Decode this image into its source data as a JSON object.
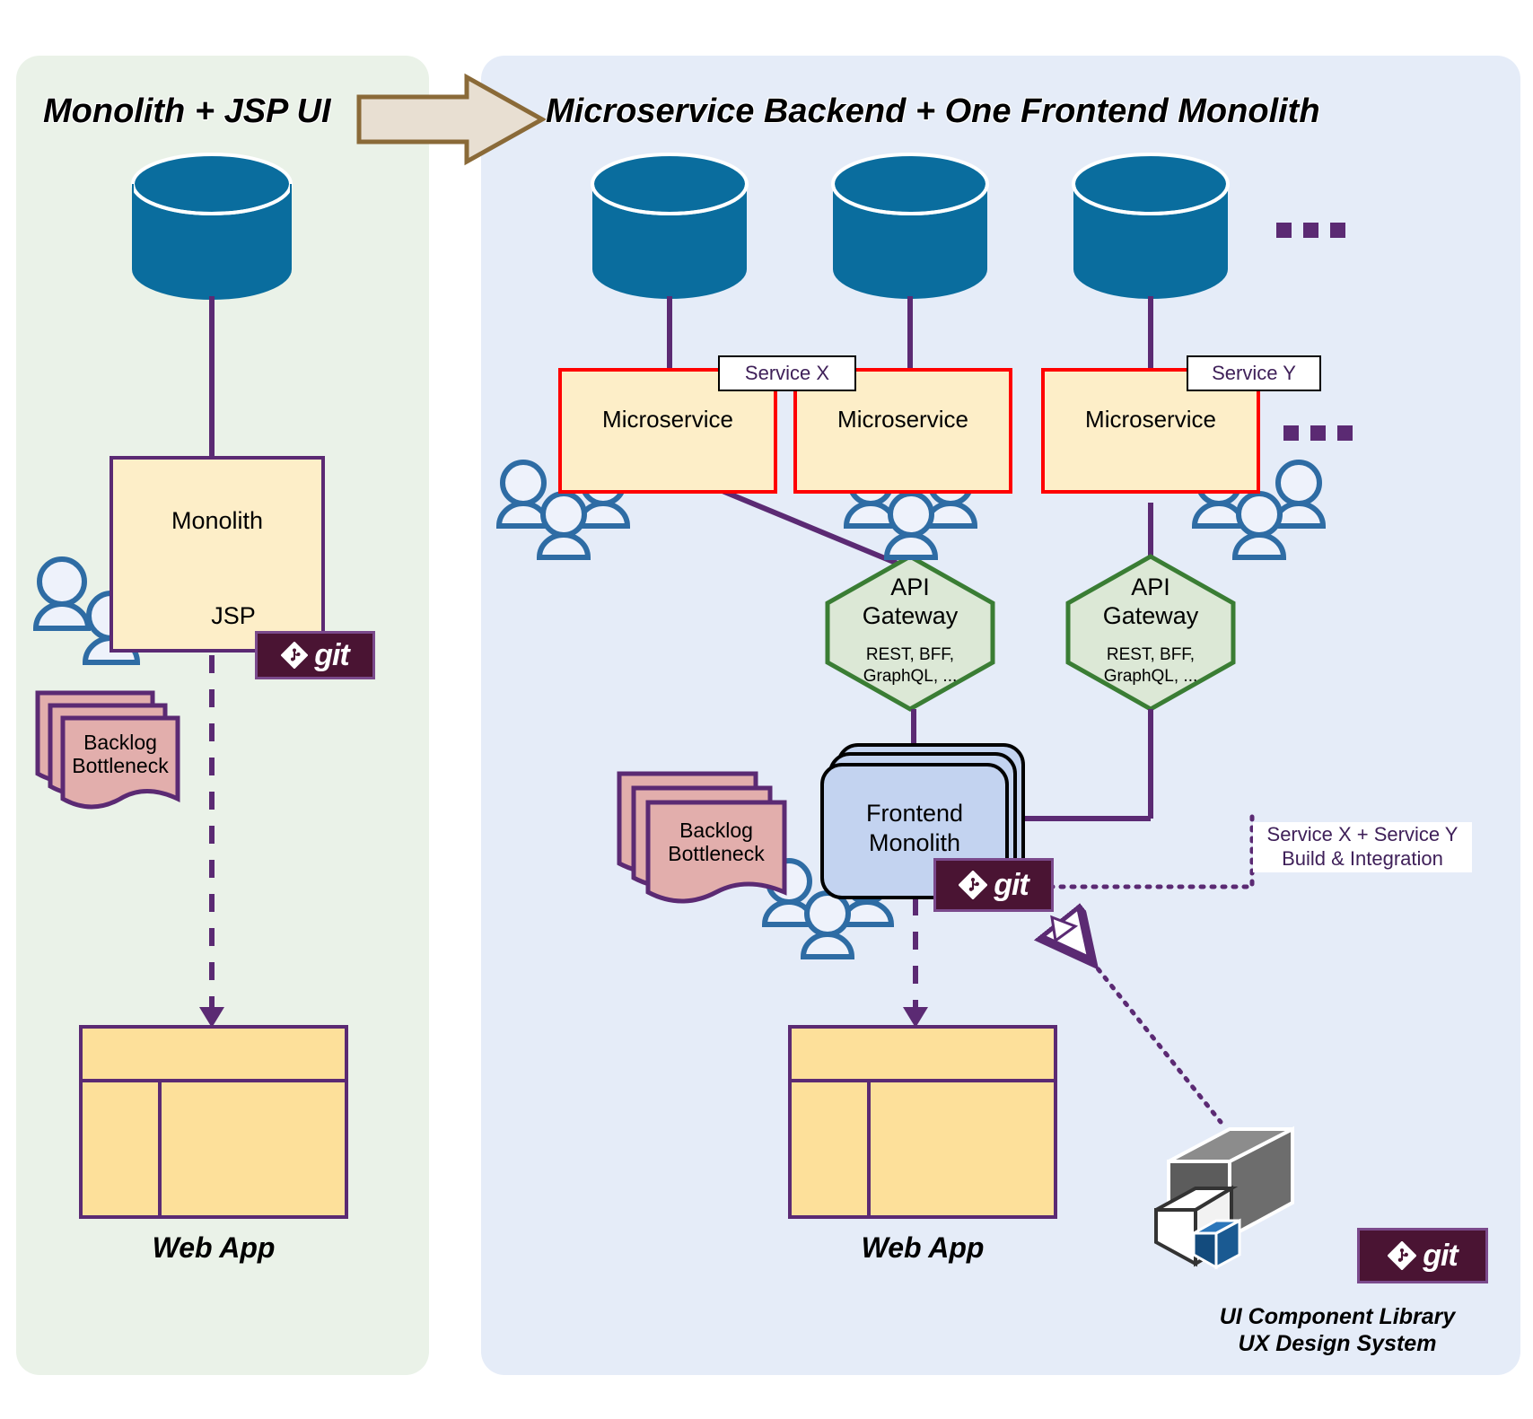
{
  "panels": {
    "left": {
      "title": "Monolith + JSP UI"
    },
    "right": {
      "title": "Microservice Backend + One Frontend Monolith"
    }
  },
  "transition_arrow": {
    "name": "right-arrow",
    "fill": "#e8dfd2",
    "stroke": "#8a6a38"
  },
  "left": {
    "database": {
      "label": "",
      "color": "#00679c"
    },
    "monolith_box": {
      "label": "Monolith"
    },
    "jsp_box": {
      "label": "JSP"
    },
    "git_badge": {
      "label": "git"
    },
    "backlog": {
      "label_line1": "Backlog",
      "label_line2": "Bottleneck"
    },
    "webapp": {
      "caption": "Web App"
    },
    "people_count": 3
  },
  "right": {
    "databases": 3,
    "database_color": "#00679c",
    "service_labels": [
      "Service X",
      "Service Y"
    ],
    "microservices": [
      {
        "label": "Microservice"
      },
      {
        "label": "Microservice"
      },
      {
        "label": "Microservice"
      }
    ],
    "gateways": [
      {
        "title_line1": "API",
        "title_line2": "Gateway",
        "sub_line1": "REST, BFF,",
        "sub_line2": "GraphQL, ..."
      },
      {
        "title_line1": "API",
        "title_line2": "Gateway",
        "sub_line1": "REST, BFF,",
        "sub_line2": "GraphQL, ..."
      }
    ],
    "frontend_monolith": {
      "label_line1": "Frontend",
      "label_line2": "Monolith"
    },
    "backlog": {
      "label_line1": "Backlog",
      "label_line2": "Bottleneck"
    },
    "git_badge": {
      "label": "git"
    },
    "integration_label": {
      "line1": "Service X + Service Y",
      "line2": "Build & Integration"
    },
    "webapp": {
      "caption": "Web App"
    },
    "component_library": {
      "git_badge_label": "git",
      "caption_line1": "UI Component Library",
      "caption_line2": "UX Design System"
    },
    "ellipsis_top": "…",
    "ellipsis_mid": "…"
  },
  "colors": {
    "panel_left_bg": "#eaf2e8",
    "panel_right_bg": "#e5ecf8",
    "db_blue": "#00679c",
    "box_yellow": "#fdeec8",
    "webapp_yellow": "#fde09a",
    "purple": "#5b2a73",
    "red": "#ff0000",
    "green": "#3a7d34",
    "gateway_fill": "#dce8d6",
    "backlog_pink": "#e2aeac",
    "frontend_blue": "#c3d3f0",
    "git_dark": "#4a1433",
    "person_blue": "#2e6ca4"
  }
}
